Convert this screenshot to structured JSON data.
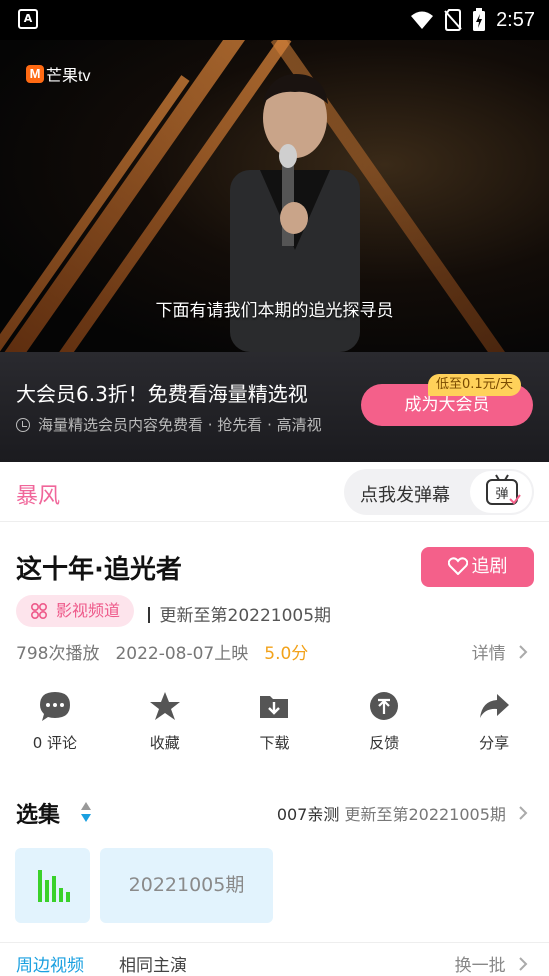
{
  "status_bar": {
    "time": "2:57"
  },
  "video": {
    "logo_text": "芒果tv",
    "subtitle": "下面有请我们本期的追光探寻员"
  },
  "promo": {
    "title": "大会员6.3折！免费看海量精选视",
    "subtitle": "海量精选会员内容免费看 · 抢先看 · 高清视",
    "vip_button": "成为大会员",
    "vip_tag": "低至0.1元/天"
  },
  "tabbar": {
    "storm_label": "暴风",
    "danmu_placeholder": "点我发弹幕",
    "danmu_icon_text": "弹"
  },
  "show": {
    "title": "这十年·追光者",
    "follow_label": "追剧",
    "channel_chip": "影视频道",
    "updated": "更新至第20221005期",
    "plays": "798次播放",
    "release": "2022-08-07上映",
    "score": "5.0分",
    "details_label": "详情"
  },
  "actions": [
    {
      "label": "0 评论",
      "icon": "comment-icon"
    },
    {
      "label": "收藏",
      "icon": "star-icon"
    },
    {
      "label": "下载",
      "icon": "download-icon"
    },
    {
      "label": "反馈",
      "icon": "feedback-icon"
    },
    {
      "label": "分享",
      "icon": "share-icon"
    }
  ],
  "episodes": {
    "heading": "选集",
    "uploader": "007亲测",
    "updated": "更新至第20221005期",
    "items": [
      {
        "label": "",
        "playing": true
      },
      {
        "label": "20221005期"
      }
    ]
  },
  "bottom_tabs": {
    "tab1": "周边视频",
    "tab2": "相同主演",
    "refresh": "换一批"
  },
  "colors": {
    "accent_pink": "#f4608a",
    "score_orange": "#f2a21a",
    "tab_blue": "#1aa0e0",
    "episode_bg": "#e2f3fd"
  }
}
